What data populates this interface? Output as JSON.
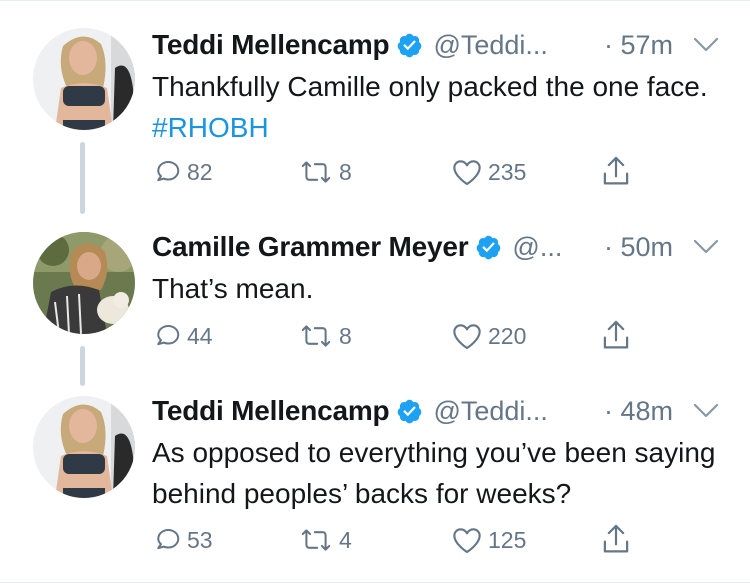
{
  "tweets": [
    {
      "display_name": "Teddi Mellencamp",
      "handle": "@Teddi...",
      "time": "· 57m",
      "text": "Thankfully Camille only packed the one face.",
      "hashtag": "#RHOBH",
      "replies": "82",
      "retweets": "8",
      "likes": "235"
    },
    {
      "display_name": "Camille Grammer Meyer",
      "handle": "@...",
      "time": "· 50m",
      "text": "That’s mean.",
      "replies": "44",
      "retweets": "8",
      "likes": "220"
    },
    {
      "display_name": "Teddi Mellencamp",
      "handle": "@Teddi...",
      "time": "· 48m",
      "text": "As opposed to everything you’ve been saying behind peoples’ backs for weeks?",
      "replies": "53",
      "retweets": "4",
      "likes": "125"
    }
  ],
  "colors": {
    "text": "#14171a",
    "secondary": "#657786",
    "verified": "#1da1f2",
    "hashtag": "#1b95e0",
    "thread_line": "#ccd6dd"
  },
  "icons": [
    "verified-badge-icon",
    "chevron-down-icon",
    "reply-icon",
    "retweet-icon",
    "like-icon",
    "share-icon"
  ]
}
